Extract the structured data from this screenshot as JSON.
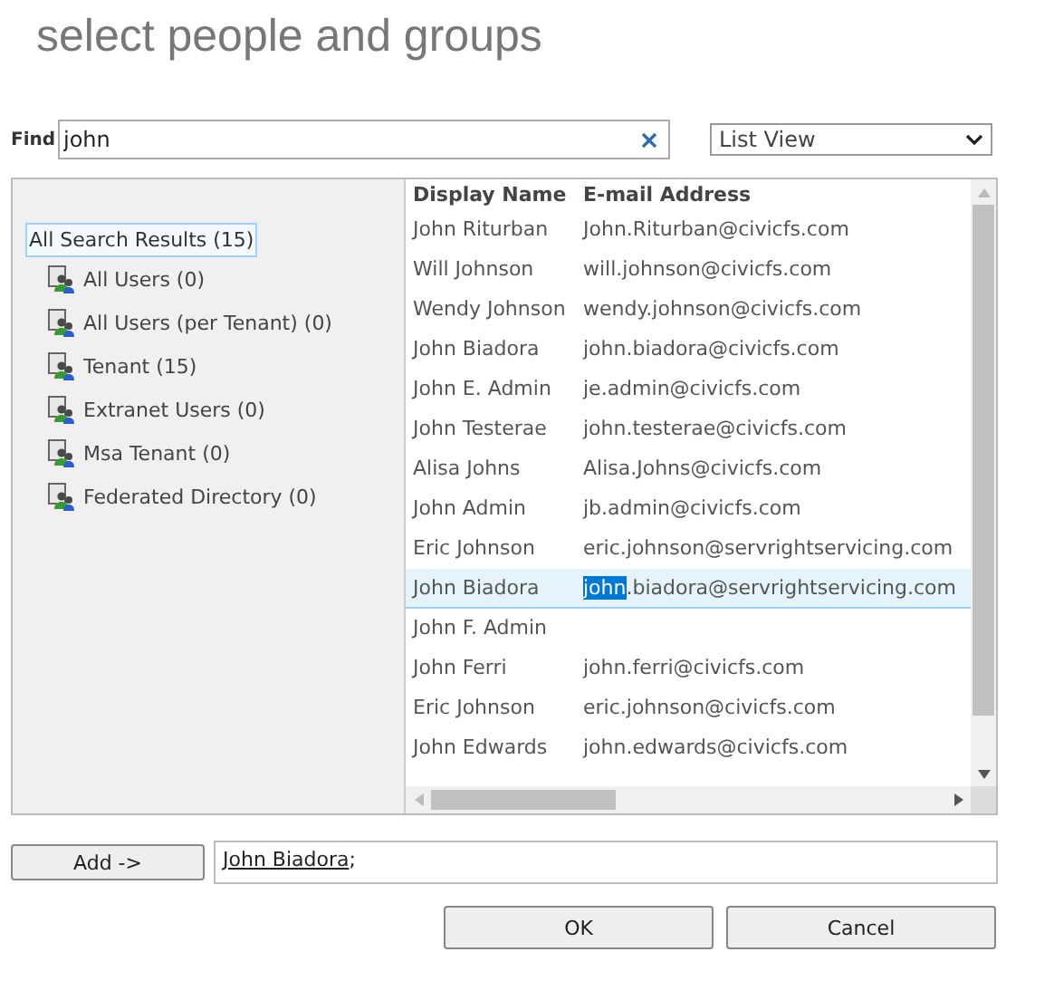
{
  "title": "select people and groups",
  "find": {
    "label": "Find",
    "value": "john"
  },
  "view_select": {
    "value": "List View"
  },
  "tree": {
    "label": "All Search Results (15)",
    "selected": true,
    "children": [
      {
        "label": "All Users (0)",
        "selected": false
      },
      {
        "label": "All Users (per Tenant) (0)",
        "selected": false
      },
      {
        "label": "Tenant (15)",
        "selected": false
      },
      {
        "label": "Extranet Users (0)",
        "selected": false
      },
      {
        "label": "Msa Tenant (0)",
        "selected": false
      },
      {
        "label": "Federated Directory (0)",
        "selected": false
      }
    ]
  },
  "table": {
    "columns": [
      "Display Name",
      "E-mail Address"
    ],
    "rows": [
      {
        "name": "John Riturban",
        "email": "John.Riturban@civicfs.com",
        "selected": false
      },
      {
        "name": "Will Johnson",
        "email": "will.johnson@civicfs.com",
        "selected": false
      },
      {
        "name": "Wendy Johnson",
        "email": "wendy.johnson@civicfs.com",
        "selected": false
      },
      {
        "name": "John Biadora",
        "email": "john.biadora@civicfs.com",
        "selected": false
      },
      {
        "name": "John E. Admin",
        "email": "je.admin@civicfs.com",
        "selected": false
      },
      {
        "name": "John Testerae",
        "email": "john.testerae@civicfs.com",
        "selected": false
      },
      {
        "name": "Alisa Johns",
        "email": "Alisa.Johns@civicfs.com",
        "selected": false
      },
      {
        "name": "John Admin",
        "email": "jb.admin@civicfs.com",
        "selected": false
      },
      {
        "name": "Eric Johnson",
        "email": "eric.johnson@servrightservicing.com",
        "selected": false
      },
      {
        "name": "John Biadora",
        "email_segments": [
          {
            "text": "john",
            "highlighted": true
          },
          {
            "text": ".biadora@servrightservicing.com",
            "highlighted": false
          }
        ],
        "selected": true
      },
      {
        "name": "John F. Admin",
        "selected": false
      },
      {
        "name": "John Ferri",
        "email": "john.ferri@civicfs.com",
        "selected": false
      },
      {
        "name": "Eric Johnson",
        "email": "eric.johnson@civicfs.com",
        "selected": false
      },
      {
        "name": "John Edwards",
        "email": "john.edwards@civicfs.com",
        "selected": false
      }
    ]
  },
  "add_button": "Add ->",
  "selected_people": {
    "name": "John Biadora",
    "separator": ";"
  },
  "buttons": [
    "OK",
    "Cancel"
  ]
}
